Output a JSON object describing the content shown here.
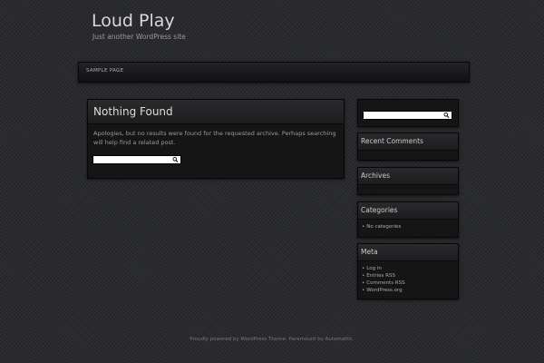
{
  "site": {
    "title": "Loud Play",
    "tagline": "Just another WordPress site"
  },
  "nav": {
    "items": [
      "SAMPLE PAGE"
    ]
  },
  "content": {
    "title": "Nothing Found",
    "message": "Apologies, but no results were found for the requested archive. Perhaps searching will help find a related post.",
    "search_value": ""
  },
  "sidebar": {
    "search_value": "",
    "recent_comments": {
      "title": "Recent Comments"
    },
    "archives": {
      "title": "Archives"
    },
    "categories": {
      "title": "Categories",
      "items": [
        "No categories"
      ]
    },
    "meta": {
      "title": "Meta",
      "items": [
        "Log in",
        "Entries RSS",
        "Comments RSS",
        "WordPress.org"
      ]
    }
  },
  "footer": {
    "text": "Proudly powered by WordPress Theme: Paramount by Automattic."
  },
  "icons": {
    "search": "search-icon"
  },
  "colors": {
    "background": "#2e2f33",
    "panel": "#151516",
    "header_gradient_top": "#2a2a2c"
  }
}
